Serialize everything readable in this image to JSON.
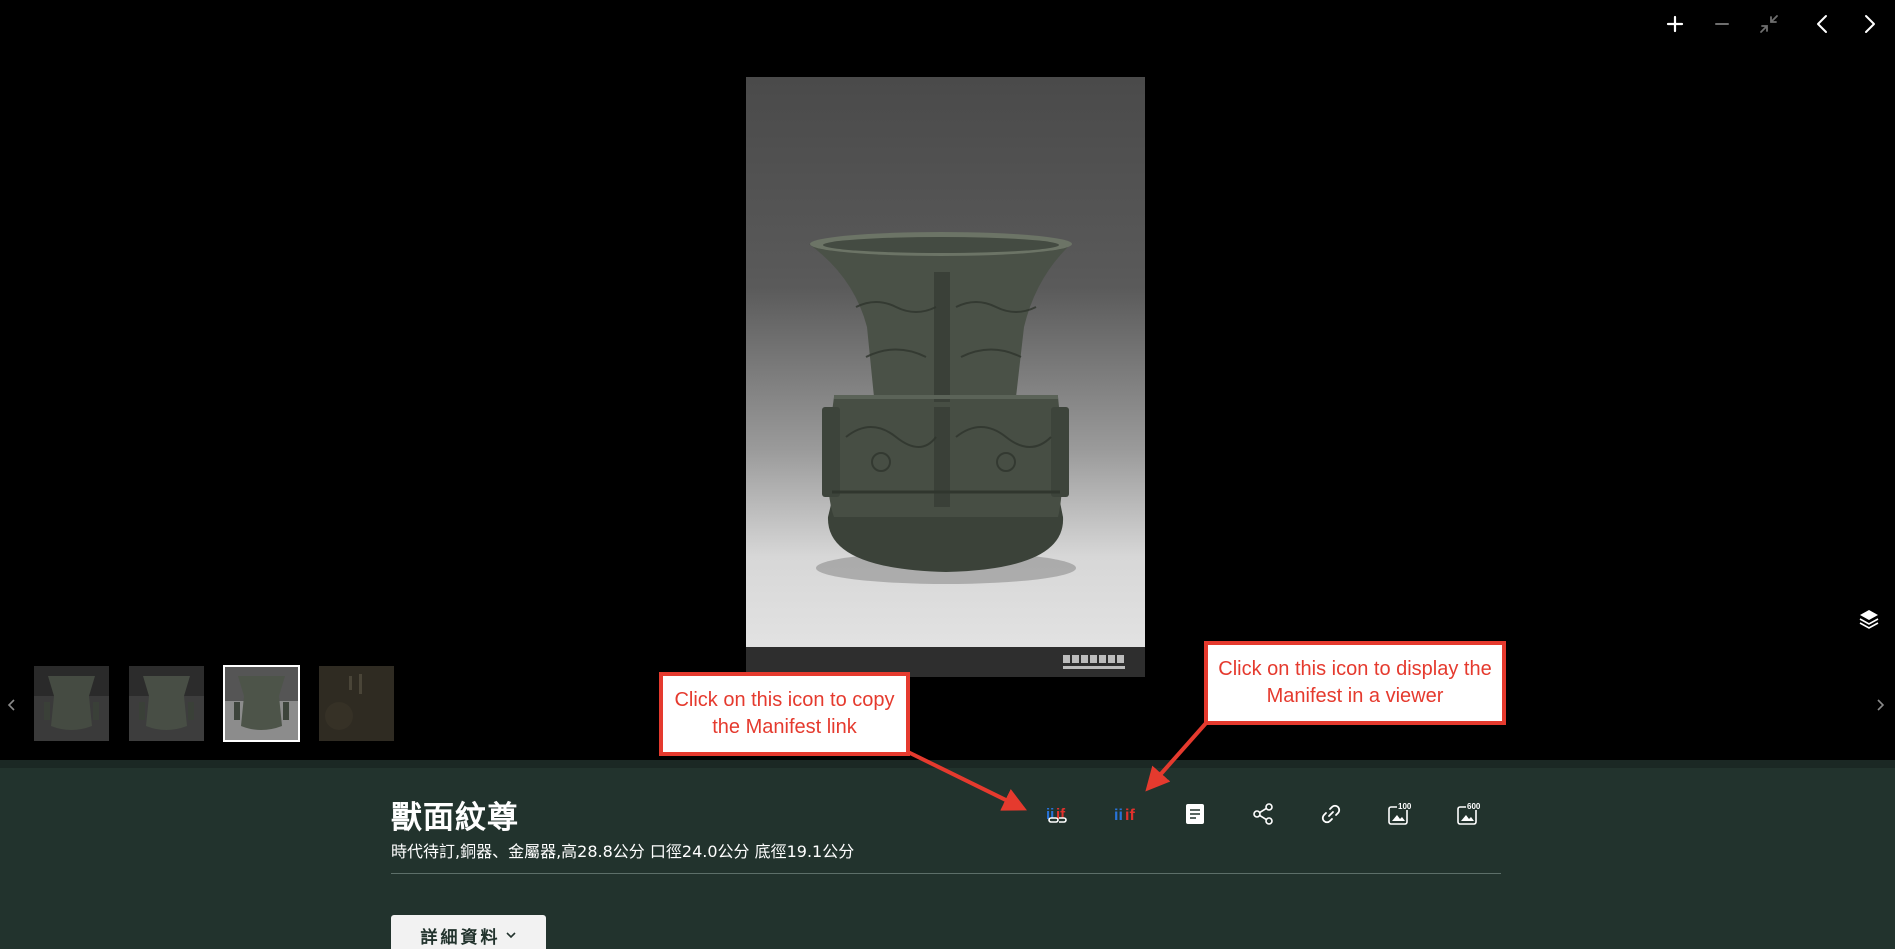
{
  "viewer": {
    "toolbar": {
      "zoom_in": "zoom-in-icon",
      "zoom_out": "zoom-out-icon",
      "exit_fullscreen": "exit-fullscreen-icon",
      "previous": "chevron-left-icon",
      "next": "chevron-right-icon"
    },
    "watermark_text": "國立故宮博物院 NATIONAL PALACE MUSEUM",
    "layers_icon": "layers-icon",
    "thumbnails": [
      {
        "label": "thumbnail-1",
        "active": false
      },
      {
        "label": "thumbnail-2",
        "active": false
      },
      {
        "label": "thumbnail-3",
        "active": true
      },
      {
        "label": "thumbnail-4",
        "active": false
      }
    ]
  },
  "info": {
    "title": "獸面紋尊",
    "subtitle": "時代待訂,銅器、金屬器,高28.8公分 口徑24.0公分 底徑19.1公分",
    "details_button": "詳細資料",
    "actions": [
      {
        "icon": "iiif-copy-link-icon"
      },
      {
        "icon": "iiif-viewer-icon"
      },
      {
        "icon": "description-icon"
      },
      {
        "icon": "share-icon"
      },
      {
        "icon": "link-icon"
      },
      {
        "icon": "download-100-icon",
        "badge": "100"
      },
      {
        "icon": "download-600-icon",
        "badge": "600"
      }
    ],
    "iiif_label": "iiif"
  },
  "annotations": {
    "copy_callout": "Click on this icon to copy the Manifest link",
    "viewer_callout": "Click on this icon to display the Manifest in a viewer",
    "accent_color": "#e53a2e"
  },
  "colors": {
    "panel_bg": "#22332d",
    "iiif_blue": "#2873d8",
    "iiif_red": "#e0312c"
  }
}
